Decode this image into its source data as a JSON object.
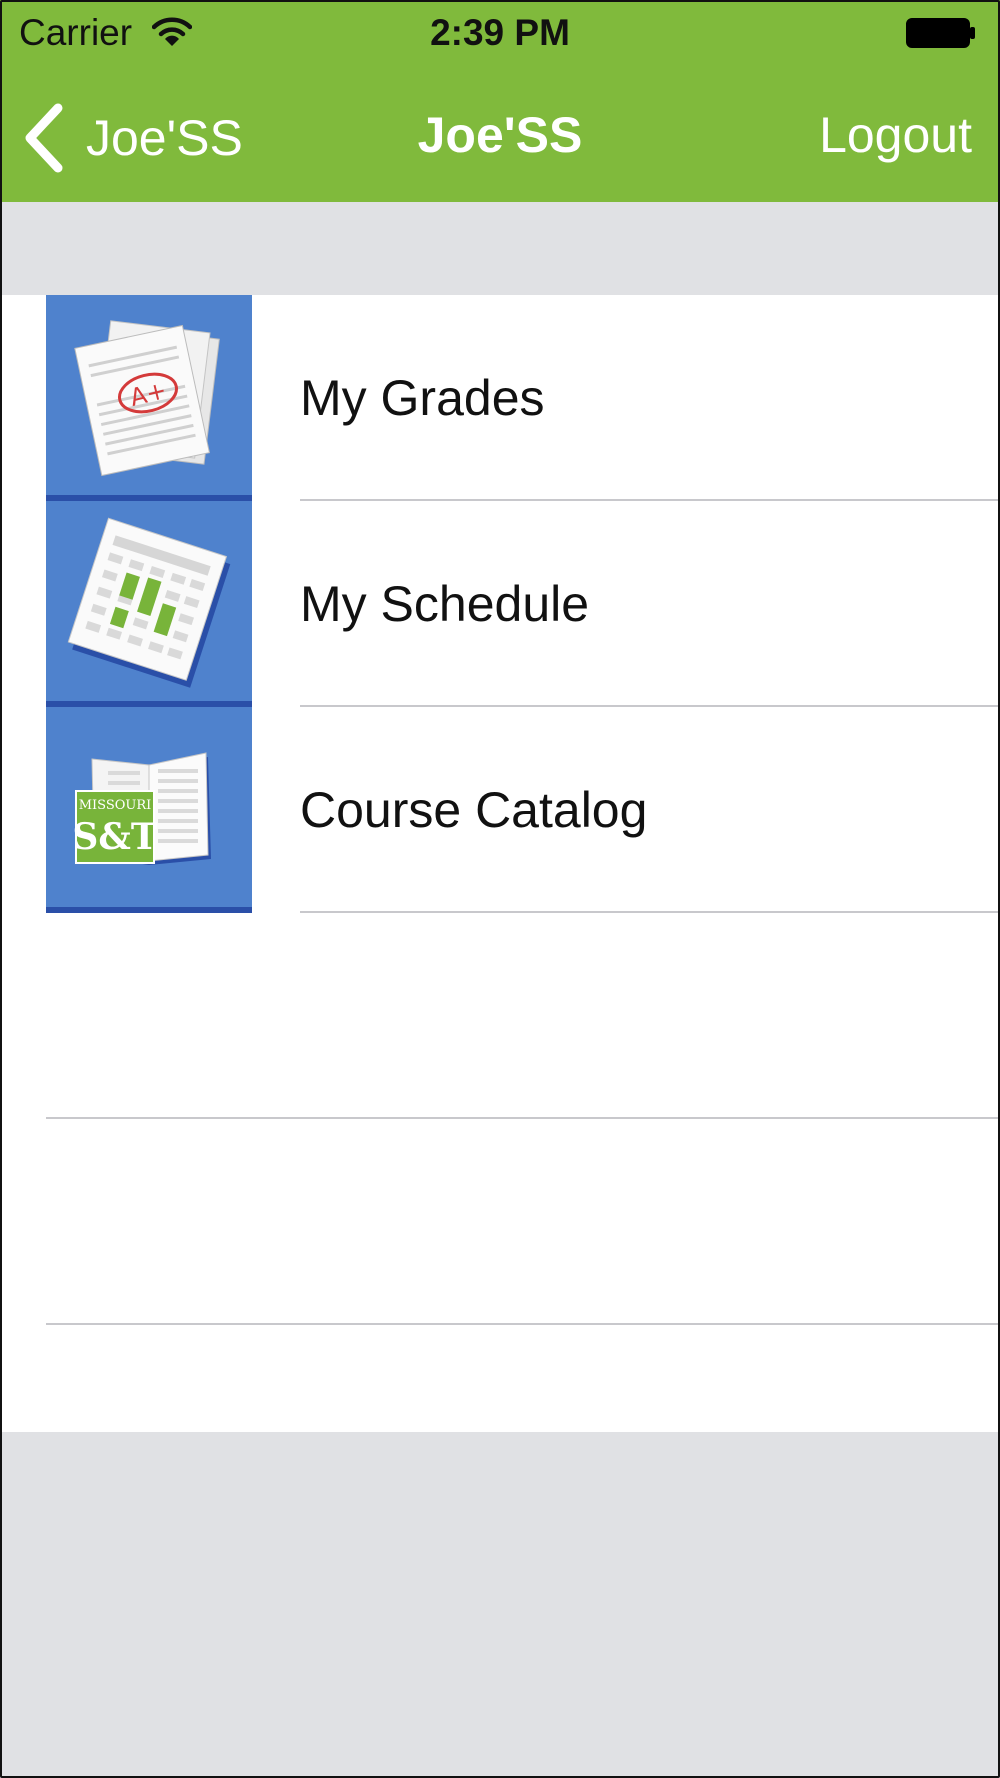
{
  "status_bar": {
    "carrier": "Carrier",
    "time": "2:39 PM",
    "wifi_icon": "wifi-icon",
    "battery_icon": "battery-icon"
  },
  "nav": {
    "back_label": "Joe'SS",
    "back_icon": "chevron-left-icon",
    "title": "Joe'SS",
    "logout_label": "Logout"
  },
  "menu": {
    "items": [
      {
        "label": "My Grades",
        "icon": "grades-icon"
      },
      {
        "label": "My Schedule",
        "icon": "schedule-icon"
      },
      {
        "label": "Course Catalog",
        "icon": "course-catalog-icon"
      }
    ]
  },
  "logo_text": "MISSOURI S&T",
  "grade_mark": "A+",
  "colors": {
    "header": "#80ba3c",
    "icon_tile": "#4f82cd",
    "icon_tile_dark": "#2a4fa8",
    "page_background": "#e0e1e4",
    "separator": "#c8c8cc"
  }
}
